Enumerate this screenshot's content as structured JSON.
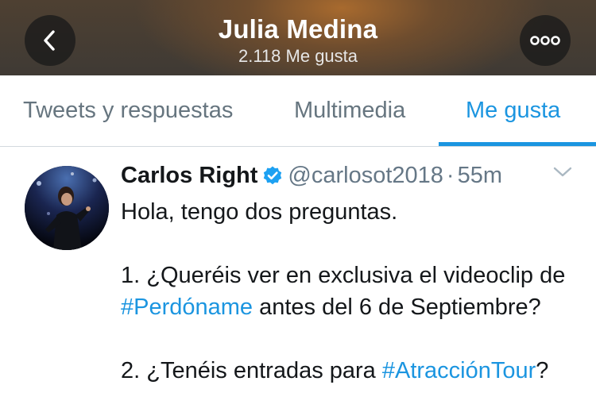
{
  "header": {
    "title": "Julia Medina",
    "subtitle": "2.118 Me gusta",
    "back_icon": "chevron-left-icon",
    "more_icon": "more-horizontal-icon"
  },
  "tabs": [
    {
      "label": "Tweets y respuestas",
      "active": false
    },
    {
      "label": "Multimedia",
      "active": false
    },
    {
      "label": "Me gusta",
      "active": true
    }
  ],
  "tweet": {
    "author_name": "Carlos Right",
    "verified": true,
    "handle": "@carlosot2018",
    "separator": "·",
    "time": "55m",
    "line1": "Hola, tengo dos preguntas.",
    "q1_prefix": "1. ¿Queréis ver en exclusiva el videoclip de ",
    "q1_hashtag": "#Perdóname",
    "q1_suffix": " antes del 6 de Septiembre?",
    "q2_prefix": "2. ¿Tenéis entradas para ",
    "q2_hashtag": "#AtracciónTour",
    "q2_suffix": "?"
  },
  "colors": {
    "accent": "#1b95e0",
    "tab_inactive": "#66757f",
    "handle": "#657786",
    "text": "#14171a"
  }
}
